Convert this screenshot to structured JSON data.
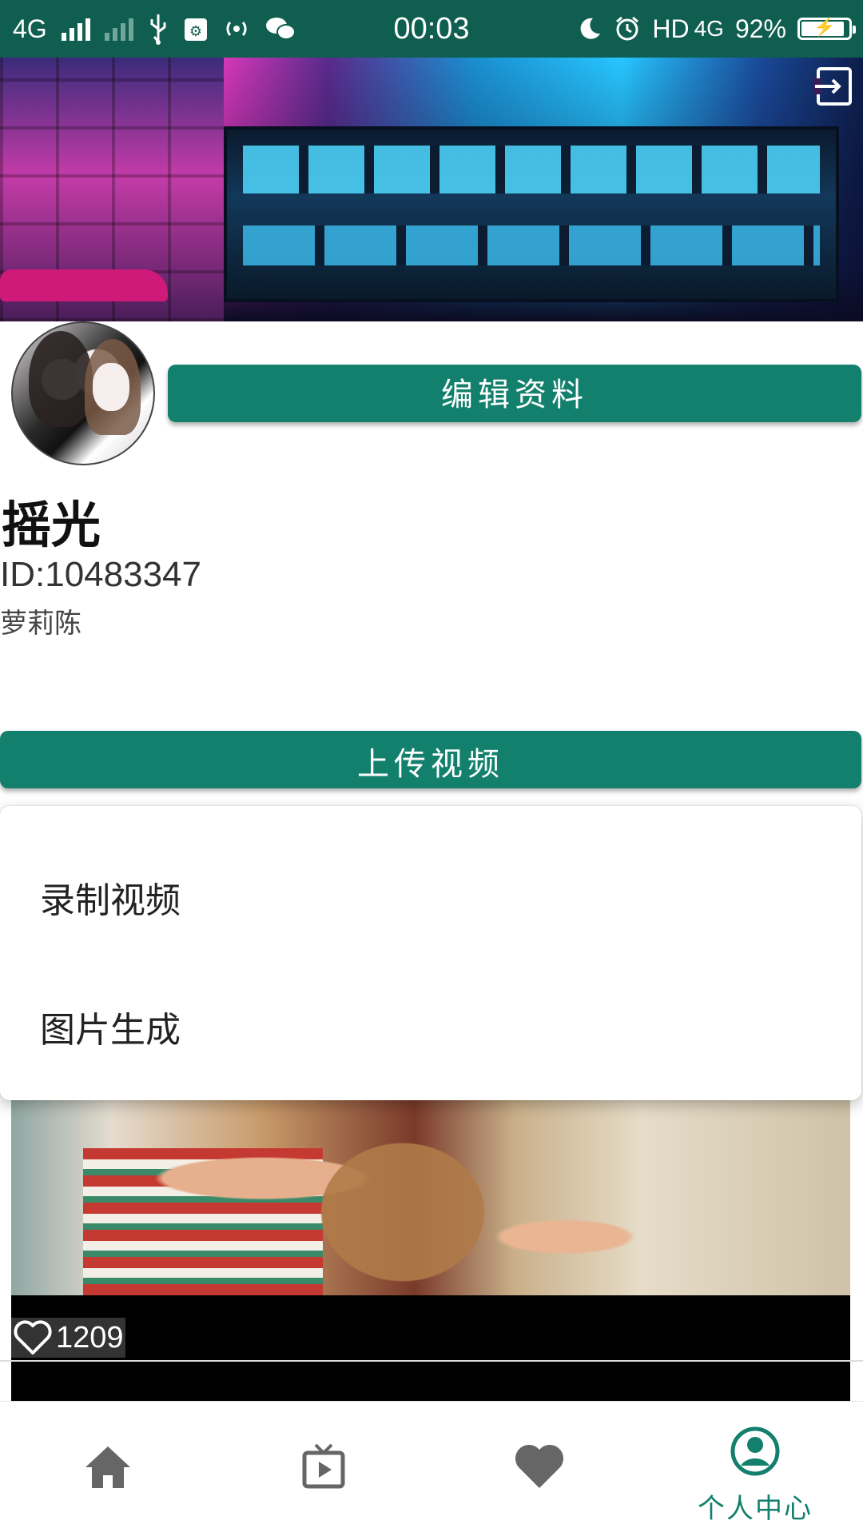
{
  "status_bar": {
    "network": "4G",
    "time": "00:03",
    "hd_label": "HD",
    "network2": "4G",
    "battery": "92%",
    "battery_level": 0.92,
    "icons": [
      "signal-icon",
      "signal-weak-icon",
      "usb-icon",
      "usb-debug-icon",
      "hotspot-icon",
      "wechat-icon",
      "moon-icon",
      "alarm-icon",
      "battery-icon"
    ]
  },
  "banner": {
    "exit_icon": "exit-icon"
  },
  "profile": {
    "edit_label": "编辑资料",
    "name": "摇光",
    "id": "ID:10483347",
    "signature": "萝莉陈"
  },
  "upload": {
    "button_label": "上传视频",
    "menu": [
      "录制视频",
      "图片生成"
    ]
  },
  "video": {
    "likes": "1209",
    "like_icon": "heart-outline-icon"
  },
  "bottom_nav": {
    "items": [
      {
        "icon": "home-icon",
        "label": ""
      },
      {
        "icon": "tv-play-icon",
        "label": ""
      },
      {
        "icon": "heart-icon",
        "label": ""
      },
      {
        "icon": "user-circle-icon",
        "label": "个人中心"
      }
    ],
    "active_color": "#12806c",
    "inactive_color": "#666666"
  },
  "colors": {
    "status_bar": "#0f5e4f",
    "primary_button": "#12806c"
  }
}
